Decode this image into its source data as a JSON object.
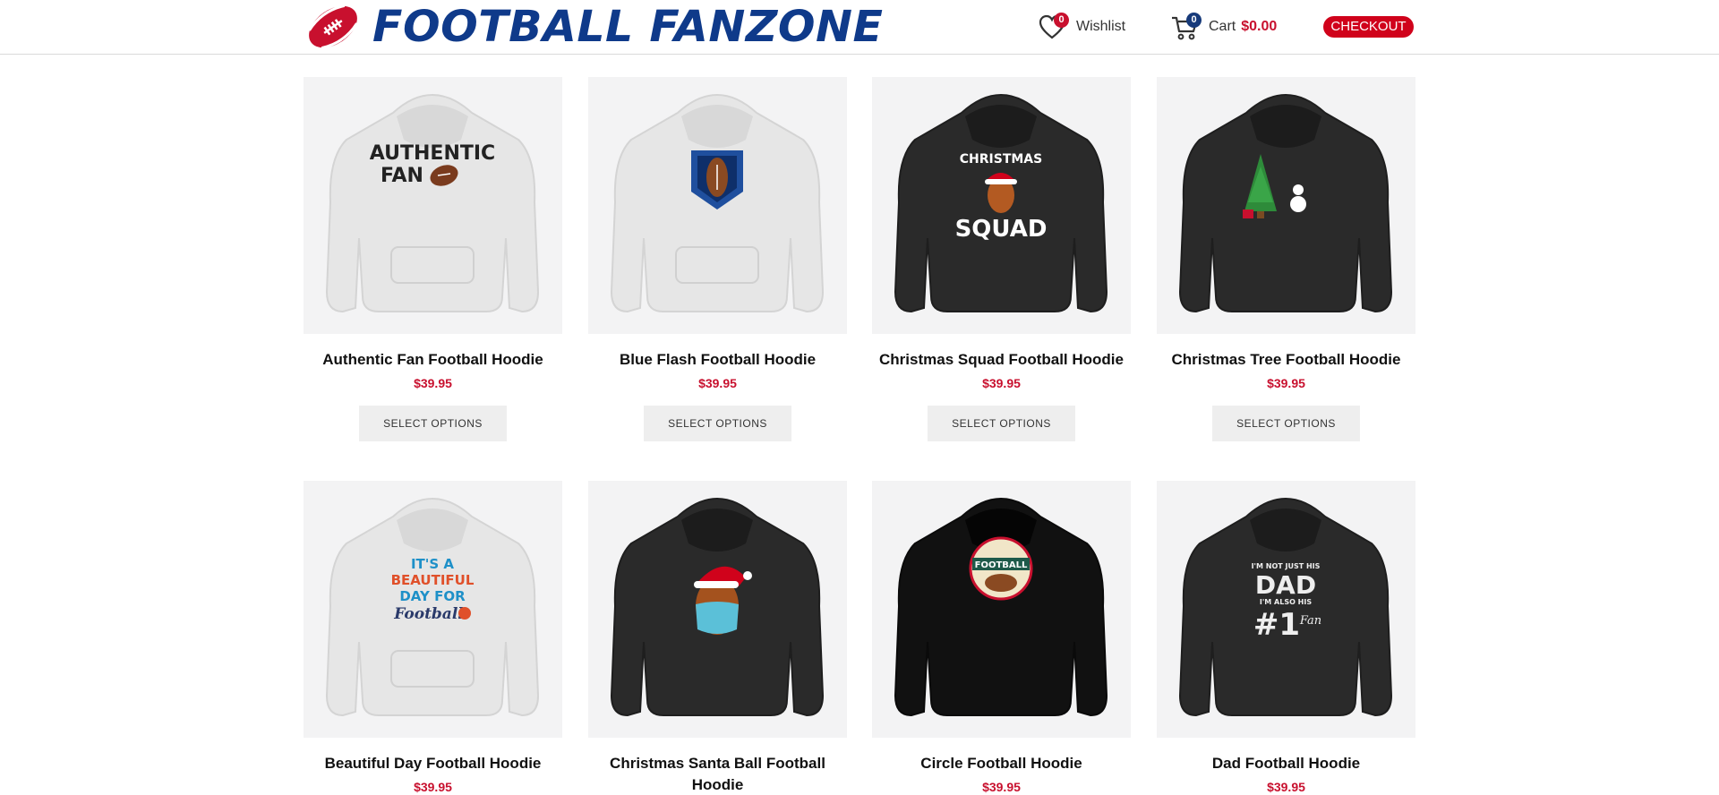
{
  "header": {
    "logo_text": "FOOTBALL FANZONE",
    "wishlist": {
      "label": "Wishlist",
      "count": "0"
    },
    "cart": {
      "label": "Cart",
      "count": "0",
      "total": "$0.00"
    },
    "checkout_label": "CHECKOUT"
  },
  "colors": {
    "brand_blue": "#0f3a8a",
    "accent_red": "#c8102e",
    "checkout_red": "#d0021b",
    "image_bg": "#f3f3f4"
  },
  "products": [
    {
      "name": "Authentic Fan Football Hoodie",
      "price": "$39.95",
      "button": "SELECT OPTIONS",
      "hoodie_color": "white",
      "design_text_1": "AUTHENTIC",
      "design_text_2": "FAN"
    },
    {
      "name": "Blue Flash Football Hoodie",
      "price": "$39.95",
      "button": "SELECT OPTIONS",
      "hoodie_color": "white"
    },
    {
      "name": "Christmas Squad Football Hoodie",
      "price": "$39.95",
      "button": "SELECT OPTIONS",
      "hoodie_color": "black",
      "design_text_1": "CHRISTMAS",
      "design_text_2": "SQUAD"
    },
    {
      "name": "Christmas Tree Football Hoodie",
      "price": "$39.95",
      "button": "SELECT OPTIONS",
      "hoodie_color": "black"
    },
    {
      "name": "Beautiful Day Football Hoodie",
      "price": "$39.95",
      "hoodie_color": "white",
      "design_text_1": "IT'S A",
      "design_text_2": "BEAUTIFUL",
      "design_text_3": "DAY FOR",
      "design_text_4": "Football"
    },
    {
      "name": "Christmas Santa Ball Football Hoodie",
      "price": "",
      "hoodie_color": "black"
    },
    {
      "name": "Circle Football Hoodie",
      "price": "$39.95",
      "hoodie_color": "black",
      "design_text_1": "FOOTBALL"
    },
    {
      "name": "Dad Football Hoodie",
      "price": "$39.95",
      "hoodie_color": "black",
      "design_text_1": "I'M NOT JUST HIS",
      "design_text_2": "DAD",
      "design_text_3": "I'M ALSO HIS",
      "design_text_4": "#1",
      "design_text_5": "Fan"
    }
  ]
}
